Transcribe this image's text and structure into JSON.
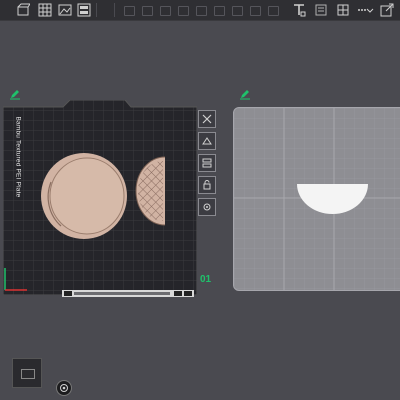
{
  "toolbar": {
    "left_tools": [
      "add-plate-icon",
      "grid-arrange-icon",
      "image-import-icon",
      "preview-icon"
    ],
    "center_tools_count": 13,
    "right_tools": [
      "text-icon",
      "sliced-view-icon",
      "grid-icon",
      "assembly-icon",
      "dropdown-icon",
      "export-icon"
    ]
  },
  "plate1": {
    "label": "Bambu Textured PEI Plate",
    "number": "01",
    "accent": "#1fc16b",
    "grid_color": "#3a3a3f",
    "plate_fill": "#25252a",
    "object_color": "#d1b3a3"
  },
  "plate2": {
    "fill": "#8e8e93",
    "object_color": "#f4f4f4"
  },
  "side_tools": [
    "close-icon",
    "auto-orient-icon",
    "arrange-icon",
    "lock-icon",
    "settings-icon"
  ]
}
